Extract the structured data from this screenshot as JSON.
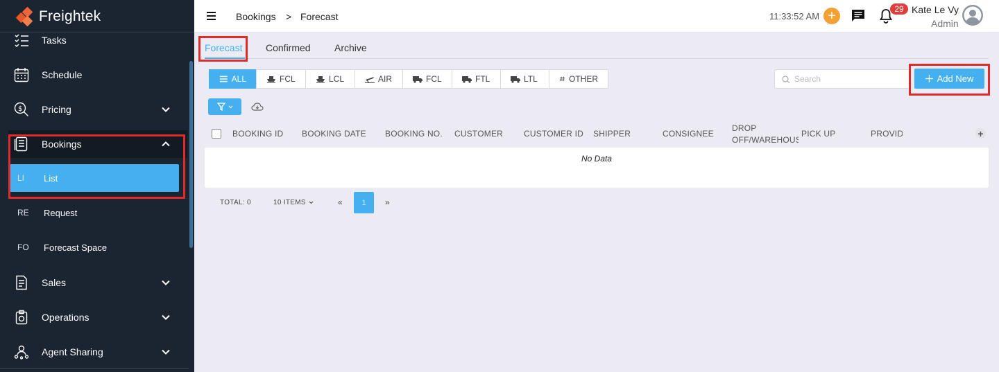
{
  "app": {
    "name": "Freightek"
  },
  "sidebar": {
    "items": [
      {
        "label": "Tasks",
        "icon": "tasks-icon"
      },
      {
        "label": "Schedule",
        "icon": "calendar-icon"
      },
      {
        "label": "Pricing",
        "icon": "pricing-icon"
      },
      {
        "label": "Bookings",
        "icon": "bookings-icon"
      },
      {
        "label": "Sales",
        "icon": "sales-icon"
      },
      {
        "label": "Operations",
        "icon": "operations-icon"
      },
      {
        "label": "Agent Sharing",
        "icon": "agent-sharing-icon"
      }
    ],
    "bookings_sub": [
      {
        "abbr": "LI",
        "label": "List"
      },
      {
        "abbr": "RE",
        "label": "Request"
      },
      {
        "abbr": "FO",
        "label": "Forecast Space"
      }
    ]
  },
  "header": {
    "breadcrumb": [
      "Bookings",
      ">",
      "Forecast"
    ],
    "time": "11:33:52 AM",
    "notification_count": "29",
    "user_name": "Kate Le Vy",
    "user_role": "Admin"
  },
  "tabs": [
    "Forecast",
    "Confirmed",
    "Archive"
  ],
  "filters": [
    "ALL",
    "FCL",
    "LCL",
    "AIR",
    "FCL",
    "FTL",
    "LTL",
    "OTHER"
  ],
  "search": {
    "placeholder": "Search"
  },
  "actions": {
    "add_new": "Add New"
  },
  "table": {
    "columns": [
      "BOOKING ID",
      "BOOKING DATE",
      "BOOKING NO.",
      "CUSTOMER",
      "CUSTOMER ID",
      "SHIPPER",
      "CONSIGNEE",
      "DROP OFF/WAREHOUS",
      "PICK UP",
      "PROVIDE"
    ],
    "empty_text": "No Data"
  },
  "pagination": {
    "total": "TOTAL: 0",
    "page_size": "10 ITEMS",
    "prev": "«",
    "current": "1",
    "next": "»"
  },
  "colors": {
    "accent": "#45b0f0",
    "sidebar_bg": "#1b2431",
    "highlight_red": "#e02b2b",
    "badge_red": "#e23b3b"
  }
}
